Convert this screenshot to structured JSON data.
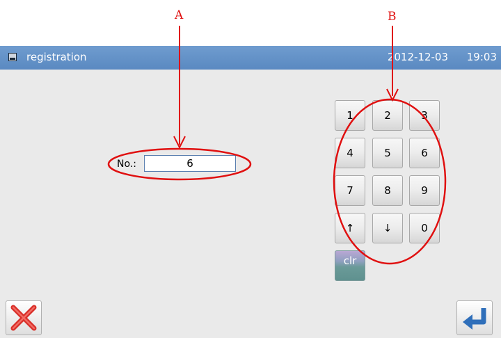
{
  "annotations": {
    "label_a": "A",
    "label_b": "B"
  },
  "titlebar": {
    "icon": "terminal-icon",
    "title": "registration",
    "date": "2012-12-03",
    "time": "19:03"
  },
  "form": {
    "no_label": "No.:",
    "no_value": "6"
  },
  "keypad": {
    "keys": [
      "1",
      "2",
      "3",
      "4",
      "5",
      "6",
      "7",
      "8",
      "9",
      "↑",
      "↓",
      "0"
    ],
    "clear": "clr"
  },
  "footer": {
    "cancel_icon": "close-x-icon",
    "enter_icon": "enter-return-icon"
  },
  "colors": {
    "titlebar": "#6494c8",
    "annotation": "#e01010",
    "background": "#eaeaea"
  }
}
